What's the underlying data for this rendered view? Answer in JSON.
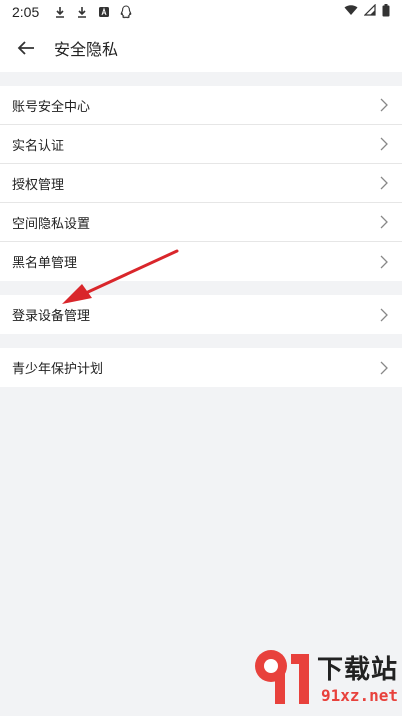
{
  "status": {
    "time": "2:05"
  },
  "header": {
    "title": "安全隐私"
  },
  "groups": [
    {
      "items": [
        {
          "label": "账号安全中心"
        },
        {
          "label": "实名认证"
        },
        {
          "label": "授权管理"
        },
        {
          "label": "空间隐私设置"
        },
        {
          "label": "黑名单管理"
        }
      ]
    },
    {
      "items": [
        {
          "label": "登录设备管理"
        }
      ]
    },
    {
      "items": [
        {
          "label": "青少年保护计划"
        }
      ]
    }
  ],
  "watermark": {
    "cn": "下载站",
    "url": "91xz.net"
  },
  "colors": {
    "accent_arrow": "#d9262b",
    "watermark_red": "#e8413c"
  }
}
